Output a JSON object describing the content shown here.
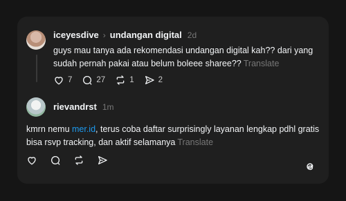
{
  "post1": {
    "username": "iceyesdive",
    "reply_to_separator": "›",
    "reply_to": "undangan digital",
    "time": "2d",
    "text": "guys mau tanya ada rekomendasi undangan digital kah?? dari yang sudah pernah pakai atau belum boleee sharee??",
    "translate_label": "Translate",
    "likes": "7",
    "comments": "27",
    "reposts": "1",
    "shares": "2"
  },
  "post2": {
    "username": "rievandrst",
    "time": "1m",
    "text_before_link": "kmrn nemu ",
    "link_text": "mer.id",
    "text_after_link": ", terus coba daftar surprisingly layanan lengkap pdhl gratis bisa rsvp tracking, dan aktif selamanya",
    "translate_label": "Translate"
  },
  "icons": {
    "like": "heart-icon",
    "comment": "comment-bubble-icon",
    "repost": "repost-icon",
    "share": "send-icon",
    "logo": "threads-logo-icon"
  },
  "colors": {
    "background": "#151515",
    "card": "#1f1f1f",
    "text": "#f3f5f7",
    "muted": "#777777",
    "link": "#1d9bf0"
  }
}
